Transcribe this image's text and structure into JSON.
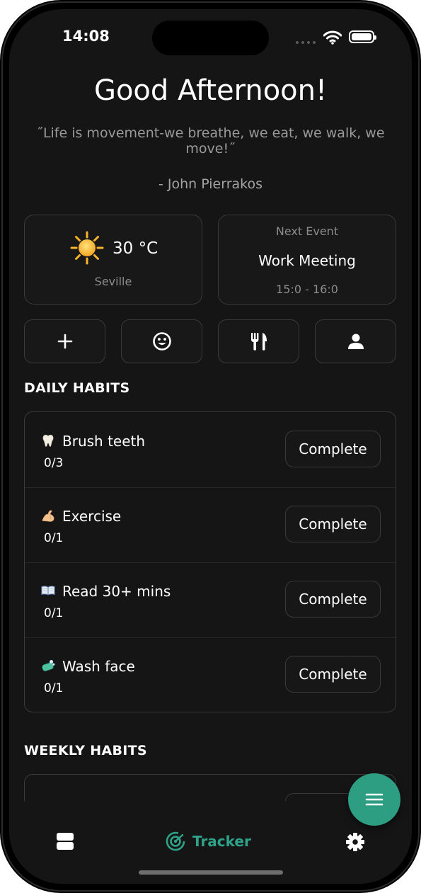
{
  "status_bar": {
    "time": "14:08",
    "icons": [
      "signal-icon",
      "wifi-icon",
      "battery-icon"
    ]
  },
  "greeting": "Good Afternoon!",
  "quote": {
    "text": "˝Life is movement-we breathe, we eat, we walk, we move!˝",
    "author": "- John Pierrakos"
  },
  "weather": {
    "icon": "sun-icon",
    "temperature": "30 °C",
    "city": "Seville"
  },
  "next_event": {
    "label": "Next Event",
    "title": "Work Meeting",
    "time": "15:0 - 16:0"
  },
  "quick_actions": [
    {
      "icon": "plus-icon"
    },
    {
      "icon": "smiley-icon"
    },
    {
      "icon": "fork-knife-icon"
    },
    {
      "icon": "person-icon"
    }
  ],
  "daily_habits": {
    "title": "DAILY HABITS",
    "items": [
      {
        "icon": "tooth-icon",
        "name": "Brush teeth",
        "count": "0/3",
        "button": "Complete"
      },
      {
        "icon": "flexed-arm-icon",
        "name": "Exercise",
        "count": "0/1",
        "button": "Complete"
      },
      {
        "icon": "open-book-icon",
        "name": "Read 30+ mins",
        "count": "0/1",
        "button": "Complete"
      },
      {
        "icon": "soap-icon",
        "name": "Wash face",
        "count": "0/1",
        "button": "Complete"
      }
    ]
  },
  "weekly_habits": {
    "title": "WEEKLY HABITS"
  },
  "fab": {
    "icon": "menu-icon"
  },
  "tab_bar": {
    "left_icon": "stack-icon",
    "center_label": "Tracker",
    "center_icon": "radar-icon",
    "right_icon": "gear-icon"
  },
  "colors": {
    "accent": "#2e9e82",
    "background": "#151515",
    "border": "#3a3a3a"
  }
}
